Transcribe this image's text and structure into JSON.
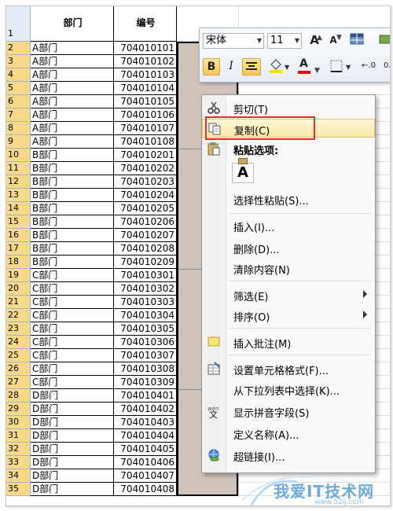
{
  "sheet": {
    "header_row": {
      "row_num": "1",
      "col_a": "部门",
      "col_b": "编号"
    },
    "rows": [
      {
        "n": "2",
        "dept": "A部门",
        "id": "704010101"
      },
      {
        "n": "3",
        "dept": "A部门",
        "id": "704010102"
      },
      {
        "n": "4",
        "dept": "A部门",
        "id": "704010103"
      },
      {
        "n": "5",
        "dept": "A部门",
        "id": "704010104"
      },
      {
        "n": "6",
        "dept": "A部门",
        "id": "704010105"
      },
      {
        "n": "7",
        "dept": "A部门",
        "id": "704010106"
      },
      {
        "n": "8",
        "dept": "A部门",
        "id": "704010107"
      },
      {
        "n": "9",
        "dept": "A部门",
        "id": "704010108"
      },
      {
        "n": "10",
        "dept": "B部门",
        "id": "704010201"
      },
      {
        "n": "11",
        "dept": "B部门",
        "id": "704010202"
      },
      {
        "n": "12",
        "dept": "B部门",
        "id": "704010203"
      },
      {
        "n": "13",
        "dept": "B部门",
        "id": "704010204"
      },
      {
        "n": "14",
        "dept": "B部门",
        "id": "704010205"
      },
      {
        "n": "15",
        "dept": "B部门",
        "id": "704010206"
      },
      {
        "n": "16",
        "dept": "B部门",
        "id": "704010207"
      },
      {
        "n": "17",
        "dept": "B部门",
        "id": "704010208"
      },
      {
        "n": "18",
        "dept": "B部门",
        "id": "704010209"
      },
      {
        "n": "19",
        "dept": "C部门",
        "id": "704010301"
      },
      {
        "n": "20",
        "dept": "C部门",
        "id": "704010302"
      },
      {
        "n": "21",
        "dept": "C部门",
        "id": "704010303"
      },
      {
        "n": "22",
        "dept": "C部门",
        "id": "704010304"
      },
      {
        "n": "23",
        "dept": "C部门",
        "id": "704010305"
      },
      {
        "n": "24",
        "dept": "C部门",
        "id": "704010306"
      },
      {
        "n": "25",
        "dept": "C部门",
        "id": "704010307"
      },
      {
        "n": "26",
        "dept": "C部门",
        "id": "704010308"
      },
      {
        "n": "27",
        "dept": "C部门",
        "id": "704010309"
      },
      {
        "n": "28",
        "dept": "D部门",
        "id": "704010401"
      },
      {
        "n": "29",
        "dept": "D部门",
        "id": "704010402"
      },
      {
        "n": "30",
        "dept": "D部门",
        "id": "704010403"
      },
      {
        "n": "31",
        "dept": "D部门",
        "id": "704010404"
      },
      {
        "n": "32",
        "dept": "D部门",
        "id": "704010405"
      },
      {
        "n": "33",
        "dept": "D部门",
        "id": "704010406"
      },
      {
        "n": "34",
        "dept": "D部门",
        "id": "704010407"
      },
      {
        "n": "35",
        "dept": "D部门",
        "id": "704010408"
      }
    ],
    "colors": {
      "selection_fill": "#cfc3ba",
      "row_header_bg": "#e4ecf7",
      "row_header_selected": "#f8d889"
    }
  },
  "minibar": {
    "font_name": "宋体",
    "font_size": "11",
    "grow_font_label": "A",
    "shrink_font_label": "A",
    "bold_label": "B",
    "italic_label": "I",
    "font_color_label": "A",
    "decimal_label": "0"
  },
  "menu": {
    "items": [
      {
        "key": "cut",
        "label": "剪切(T)",
        "icon": "scissors-icon"
      },
      {
        "key": "copy",
        "label": "复制(C)",
        "icon": "copy-icon",
        "highlighted": true
      },
      {
        "key": "paste_options",
        "label": "粘贴选项:",
        "icon": "paste-icon",
        "bold": true
      },
      {
        "key": "paste_special",
        "label": "选择性粘贴(S)..."
      },
      {
        "key": "insert",
        "label": "插入(I)..."
      },
      {
        "key": "delete",
        "label": "删除(D)..."
      },
      {
        "key": "clear",
        "label": "清除内容(N)"
      },
      {
        "key": "filter",
        "label": "筛选(E)",
        "submenu": true
      },
      {
        "key": "sort",
        "label": "排序(O)",
        "submenu": true
      },
      {
        "key": "insert_comment",
        "label": "插入批注(M)",
        "icon": "comment-icon"
      },
      {
        "key": "format_cells",
        "label": "设置单元格格式(F)...",
        "icon": "format-cells-icon"
      },
      {
        "key": "pick_list",
        "label": "从下拉列表中选择(K)..."
      },
      {
        "key": "phonetic",
        "label": "显示拼音字段(S)",
        "icon": "phonetic-icon"
      },
      {
        "key": "define_name",
        "label": "定义名称(A)..."
      },
      {
        "key": "hyperlink",
        "label": "超链接(I)...",
        "icon": "hyperlink-icon"
      }
    ],
    "paste_button_label": "A",
    "highlight_color": "#fde9a8",
    "annotation_color": "#e23030"
  },
  "watermark": {
    "text": "我爱IT技术网",
    "url": "www.52ij.com"
  }
}
